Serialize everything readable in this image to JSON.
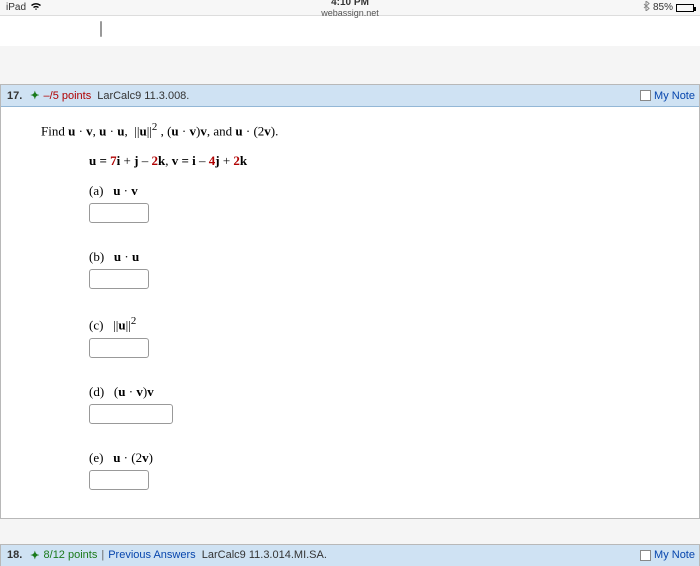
{
  "status": {
    "device": "iPad",
    "time": "4:10 PM",
    "url": "webassign.net",
    "batteryPct": "85%"
  },
  "q17": {
    "number": "17.",
    "points": "–/5 points",
    "source": "LarCalc9 11.3.008.",
    "myNotes": "My Note",
    "instruction_prefix": "Find ",
    "instruction_suffix": ".",
    "vecdef_u_prefix": "u = ",
    "vecdef_u_7": "7",
    "vecdef_u_i": "i",
    "vecdef_u_plus": " + ",
    "vecdef_u_j": "j",
    "vecdef_u_minus": " – ",
    "vecdef_u_2": "2",
    "vecdef_u_k": "k",
    "vecdef_sep": ",   ",
    "vecdef_v_prefix": "v = ",
    "vecdef_v_i": "i",
    "vecdef_v_minus": " – ",
    "vecdef_v_4": "4",
    "vecdef_v_j": "j",
    "vecdef_v_plus": " + ",
    "vecdef_v_2": "2",
    "vecdef_v_k": "k",
    "parts": {
      "a": "(a)",
      "b": "(b)",
      "c": "(c)",
      "d": "(d)",
      "e": "(e)"
    }
  },
  "q18": {
    "number": "18.",
    "points": "8/12 points",
    "prev": "Previous Answers",
    "source": "LarCalc9 11.3.014.MI.SA.",
    "myNotes": "My Note"
  }
}
